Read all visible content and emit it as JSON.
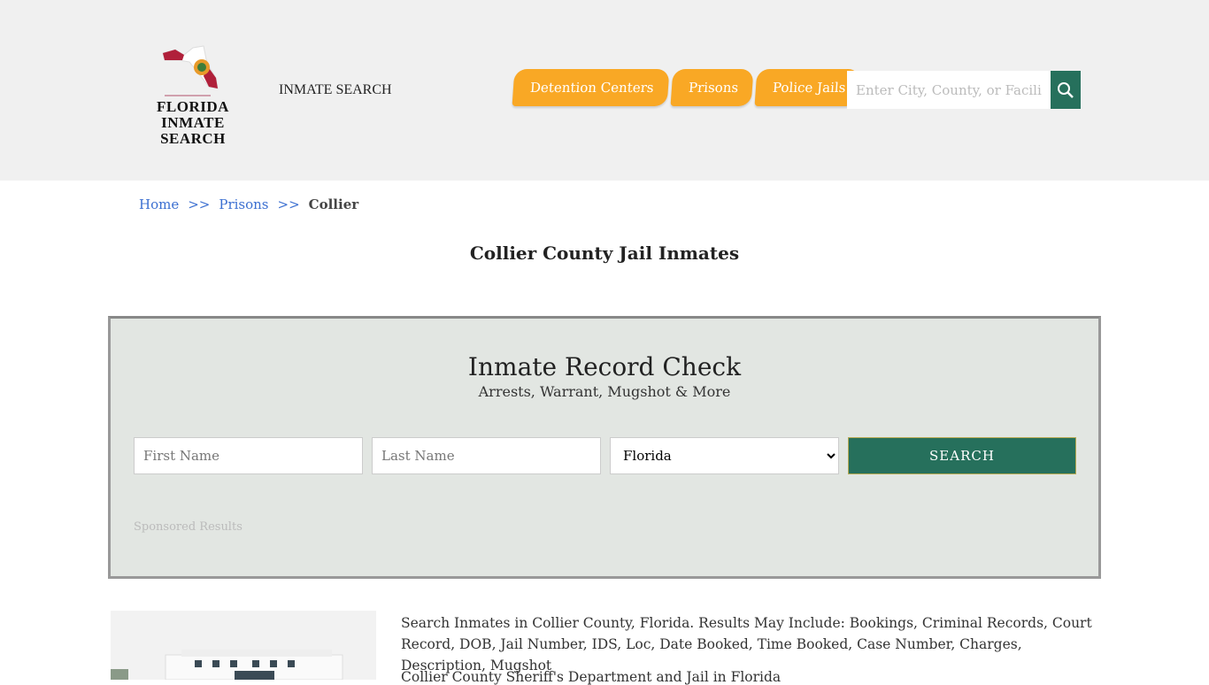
{
  "header": {
    "logo_line1": "FLORIDA",
    "logo_line2": "INMATE SEARCH",
    "site_name": "INMATE SEARCH",
    "nav": [
      "Detention Centers",
      "Prisons",
      "Police Jails"
    ],
    "search_placeholder": "Enter City, County, or Facility"
  },
  "breadcrumb": {
    "items": [
      "Home",
      "Prisons"
    ],
    "current": "Collier",
    "separator": ">>"
  },
  "page_title": "Collier County Jail Inmates",
  "record_check": {
    "title": "Inmate Record Check",
    "subtitle": "Arrests, Warrant, Mugshot & More",
    "first_name_placeholder": "First Name",
    "last_name_placeholder": "Last Name",
    "state": "Florida",
    "search_label": "SEARCH",
    "sponsored": "Sponsored Results"
  },
  "content": {
    "description": "Search Inmates in Collier County, Florida. Results May Include: Bookings, Criminal Records, Court Record, DOB, Jail Number, IDS, Loc, Date Booked, Time Booked, Case Number, Charges, Description, Mugshot",
    "line2": "Collier County Sheriff's Department and Jail in Florida"
  },
  "colors": {
    "accent": "#f9a825",
    "primary": "#26705c"
  }
}
